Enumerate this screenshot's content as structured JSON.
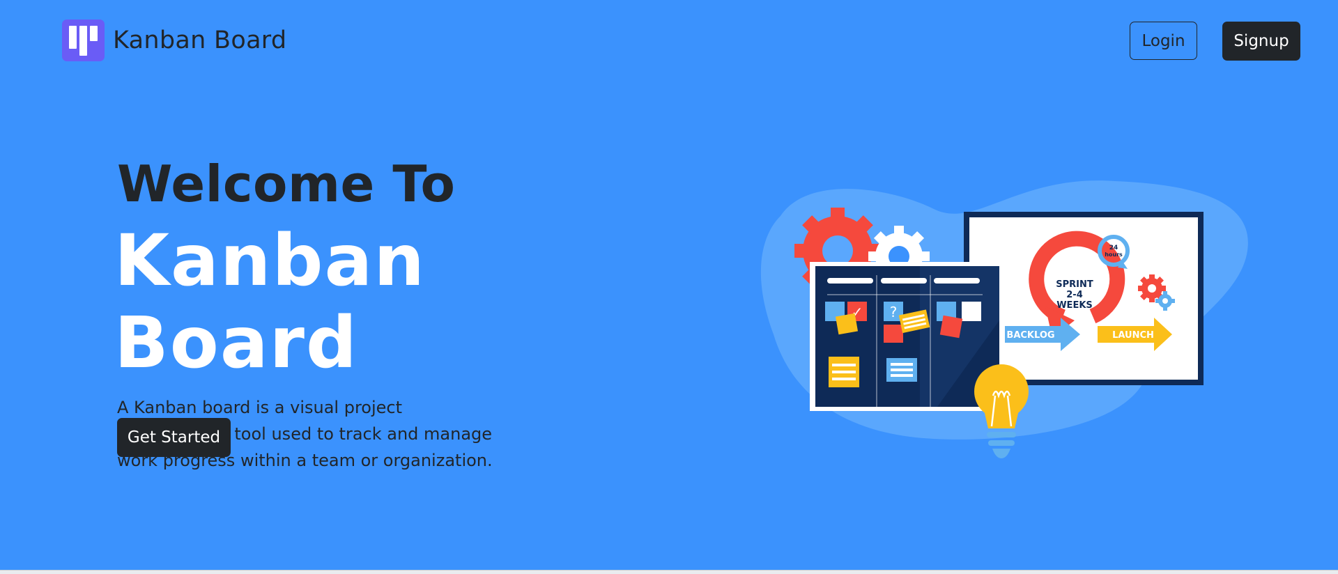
{
  "nav": {
    "brand_name": "Kanban Board",
    "login_label": "Login",
    "signup_label": "Signup"
  },
  "hero": {
    "welcome": "Welcome To",
    "title": "Kanban Board",
    "description": "A Kanban board is a visual project management tool used to track and manage work progress within a team or organization.",
    "cta_label": "Get Started"
  },
  "illustration": {
    "sprint_line1": "SPRINT",
    "sprint_line2": "2-4",
    "sprint_line3": "WEEKS",
    "timer_number": "24",
    "timer_unit": "hours",
    "backlog_label": "BACKLOG",
    "launch_label": "LAUNCH",
    "question_mark": "?",
    "check_mark": "✓"
  },
  "colors": {
    "background": "#3b92fd",
    "dark": "#212529",
    "logo": "#6a5cf6",
    "red": "#f5493d",
    "yellow": "#fbbf1a",
    "navy": "#0e2a57",
    "light_blue": "#5fb0f0"
  }
}
